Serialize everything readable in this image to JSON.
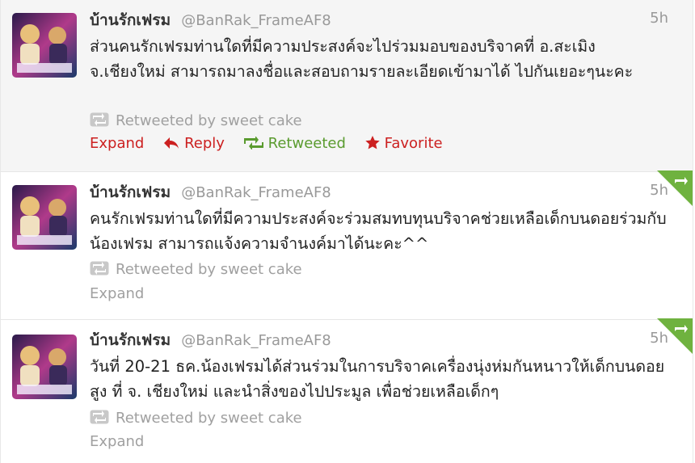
{
  "colors": {
    "link": "#cc2020",
    "retweeted": "#5a9b2f",
    "muted": "#a0a0a0",
    "corner": "#6fb23f"
  },
  "tweets": [
    {
      "name": "บ้านรักเฟรม",
      "handle": "@BanRak_FrameAF8",
      "time": "5h",
      "text": "ส่วนคนรักเฟรมท่านใดที่มีความประสงค์จะไปร่วมมอบของบริจาคที่ อ.สะเมิง จ.เชียงใหม่ สามารถมาลงชื่อและสอบถามรายละเอียดเข้ามาได้ ไปกันเยอะๆนะคะ",
      "retweeted_by": "Retweeted by sweet cake",
      "expand": "Expand",
      "reply": "Reply",
      "retweeted": "Retweeted",
      "favorite": "Favorite"
    },
    {
      "name": "บ้านรักเฟรม",
      "handle": "@BanRak_FrameAF8",
      "time": "5h",
      "text": "คนรักเฟรมท่านใดที่มีความประสงค์จะร่วมสมทบทุนบริจาคช่วยเหลือเด็กบนดอยร่วมกับน้องเฟรม สามารถแจ้งความจำนงค์มาได้นะคะ^^",
      "retweeted_by": "Retweeted by sweet cake",
      "expand": "Expand"
    },
    {
      "name": "บ้านรักเฟรม",
      "handle": "@BanRak_FrameAF8",
      "time": "5h",
      "text": "วันที่ 20-21 ธค.น้องเฟรมได้ส่วนร่วมในการบริจาคเครื่องนุ่งห่มกันหนาวให้เด็กบนดอยสูง ที่ จ. เชียงใหม่ และนำสิ่งของไปประมูล เพื่อช่วยเหลือเด็กๆ",
      "retweeted_by": "Retweeted by sweet cake",
      "expand": "Expand"
    }
  ]
}
